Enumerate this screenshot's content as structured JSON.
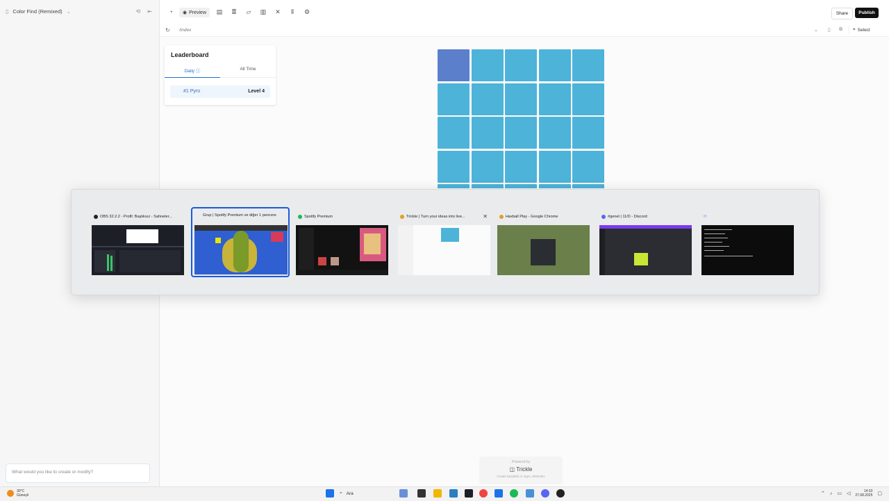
{
  "sidebar": {
    "project_name": "Color Find (Remixed)",
    "prompt_placeholder": "What would you like to create or modify?"
  },
  "toolbar": {
    "preview_label": "Preview",
    "share_label": "Share",
    "publish_label": "Publish"
  },
  "urlbar": {
    "path": "/index",
    "select_label": "Select"
  },
  "leaderboard": {
    "title": "Leaderboard",
    "tabs": [
      "Daily",
      "All Time"
    ],
    "active_tab": "Daily",
    "entry": {
      "rank": "#1",
      "name": "Pyro",
      "level": "Level 4"
    }
  },
  "game": {
    "base_color": "#4db3d9",
    "odd_color": "#5c7fcc",
    "columns": 5,
    "odd_cell_index": 0
  },
  "switcher": {
    "windows": [
      {
        "title": "OBS 32.2.2 - Profil: Başlıksız - Sahneler...",
        "app": "obs"
      },
      {
        "title": "Grup | Spotify Premium ve diğer 1 pencere",
        "app": "group",
        "selected": true
      },
      {
        "title": "Spotify Premium",
        "app": "spotify"
      },
      {
        "title": "Trickle | Turn your ideas into live...",
        "app": "chrome"
      },
      {
        "title": "Haxball Play - Google Chrome",
        "app": "chrome"
      },
      {
        "title": "#genel | 11/D - Discord",
        "app": "discord"
      },
      {
        "title": "",
        "app": "terminal"
      }
    ]
  },
  "powered": {
    "line1": "Powered by",
    "brand": "Trickle",
    "line3": "Create beautiful AI Apps, Websites"
  },
  "taskbar": {
    "weather_temp": "30°C",
    "weather_desc": "Güneşli",
    "search_label": "Ara",
    "time": "14:33",
    "date": "27.08.2025"
  }
}
